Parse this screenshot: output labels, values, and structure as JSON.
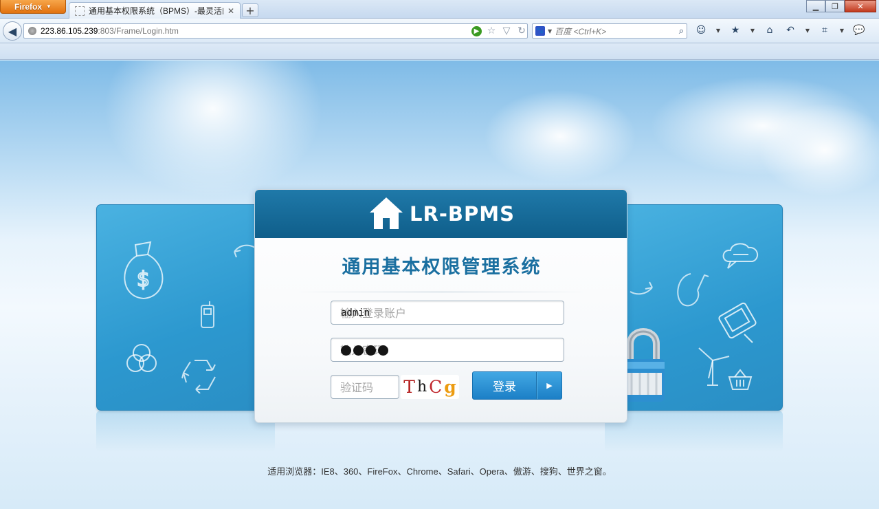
{
  "browser": {
    "menu_button": "Firefox",
    "tab_title": "通用基本权限系统（BPMS）-最灵活的...",
    "new_tab": "+",
    "url_host": "223.86.105.239",
    "url_path": ":803/Frame/Login.htm",
    "search_placeholder": "百度 <Ctrl+K>"
  },
  "login": {
    "logo_text": "LR-BPMS",
    "system_title": "通用基本权限管理系统",
    "account_placeholder": "输入登录账户",
    "account_value": "admin",
    "password_placeholder": "输入密码",
    "password_dot_count": 4,
    "captcha_placeholder": "验证码",
    "captcha_chars": [
      "T",
      "h",
      "C",
      "g"
    ],
    "login_button": "登录"
  },
  "footer": {
    "browsers_note": "适用浏览器：IE8、360、FireFox、Chrome、Safari、Opera、傲游、搜狗、世界之窗。"
  },
  "colors": {
    "header_blue": "#1a6fa0",
    "button_blue": "#2a8fd6",
    "panel_blue": "#2c98cf"
  }
}
